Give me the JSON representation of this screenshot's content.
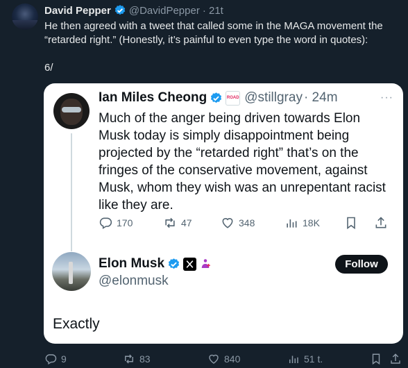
{
  "tweet": {
    "author_name": "David Pepper",
    "handle": "@DavidPepper",
    "time": "· 21t",
    "text": "He then agreed with a tweet that called some in the MAGA movement the “retarded right.” (Honestly, it’s painful to even type the word in quotes):",
    "thread_index": "6/"
  },
  "quoted": {
    "author_name": "Ian Miles Cheong",
    "handle": "@stillgray",
    "time": "· 24m",
    "more": "···",
    "badge_text": "ROAD",
    "text": "Much of the anger being driven towards Elon Musk today is simply disappointment being projected by the “retarded right” that’s on the fringes of the conservative movement, against Musk, whom they wish was an unrepentant racist like they are.",
    "replies": "170",
    "reposts": "47",
    "likes": "348",
    "views": "18K"
  },
  "reply": {
    "author_name": "Elon Musk",
    "handle": "@elonmusk",
    "follow_label": "Follow",
    "text": "Exactly"
  },
  "actions": {
    "replies": "9",
    "reposts": "83",
    "likes": "840",
    "views": "51 t."
  },
  "colors": {
    "background": "#15202b",
    "card": "#ffffff",
    "verified": "#1d9bf0",
    "muted": "#8b98a5"
  }
}
